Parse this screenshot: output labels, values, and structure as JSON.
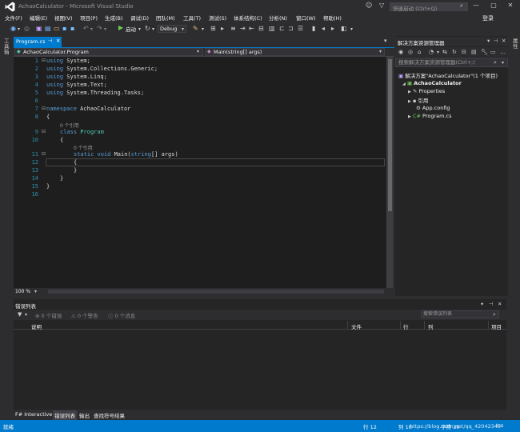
{
  "window": {
    "title": "AchaoCalculator - Microsoft Visual Studio",
    "quick_launch_placeholder": "快速启动 (Ctrl+Q)",
    "controls": [
      "—",
      "▢",
      "✕"
    ]
  },
  "menu": [
    "文件(F)",
    "编辑(E)",
    "视图(V)",
    "项目(P)",
    "生成(B)",
    "调试(D)",
    "团队(M)",
    "工具(T)",
    "测试(S)",
    "体系结构(C)",
    "分析(N)",
    "窗口(W)",
    "帮助(H)"
  ],
  "login_label": "登录",
  "toolbar": {
    "start_label": "启动",
    "config_value": "Debug"
  },
  "left_strip": {
    "toolbox_label": "工具箱"
  },
  "editor": {
    "tab_label": "Program.cs",
    "nav_left": "AchaoCalculator.Program",
    "nav_right": "Main(string[] args)",
    "zoom": "100 %",
    "ref_count_label": "0 个引用",
    "lines": [
      {
        "n": "1",
        "kw": "using",
        "rest": " System;"
      },
      {
        "n": "2",
        "kw": "using",
        "rest": " System.Collections.Generic;"
      },
      {
        "n": "3",
        "kw": "using",
        "rest": " System.Linq;"
      },
      {
        "n": "4",
        "kw": "using",
        "rest": " System.Text;"
      },
      {
        "n": "5",
        "kw": "using",
        "rest": " System.Threading.Tasks;"
      },
      {
        "n": "6"
      },
      {
        "n": "7",
        "kw": "namespace",
        "rest": " AchaoCalculator"
      },
      {
        "n": "8",
        "rest": "{"
      },
      {
        "n": "9",
        "kw": "class",
        "type": "Program"
      },
      {
        "n": "10",
        "rest": "{"
      },
      {
        "n": "11",
        "kw": "static void",
        "rest": " Main(",
        "kw2": "string",
        "rest2": "[] args)"
      },
      {
        "n": "12",
        "rest": "{"
      },
      {
        "n": "13",
        "rest": "}"
      },
      {
        "n": "14",
        "rest": "}"
      },
      {
        "n": "15",
        "rest": "}"
      },
      {
        "n": "16"
      }
    ]
  },
  "solution_explorer": {
    "title": "解决方案资源管理器",
    "search_placeholder": "搜索解决方案资源管理器(Ctrl+;)",
    "items": [
      {
        "label": "解决方案\"AchaoCalculator\"(1 个项目)"
      },
      {
        "label": "AchaoCalculator"
      },
      {
        "label": "Properties"
      },
      {
        "label": "引用"
      },
      {
        "label": "App.config"
      },
      {
        "label": "Program.cs"
      }
    ]
  },
  "right_strip": {
    "properties_label": "属性"
  },
  "error_list": {
    "title": "错误列表",
    "errors_label": "0 个错误",
    "warnings_label": "0 个警告",
    "messages_label": "0 个消息",
    "search_placeholder": "搜索错误列表",
    "columns": [
      "说明",
      "文件",
      "行",
      "列",
      "项目"
    ]
  },
  "bottom_tabs": [
    "F# Interactive",
    "错误列表",
    "输出",
    "查找符号结果"
  ],
  "status": {
    "left": "就绪",
    "line": "行 12",
    "col": "列 10",
    "char": "字符 10",
    "mode": "Ins",
    "watermark": "https://blog.csdn.net/qq_42042345"
  },
  "colors": {
    "accent": "#007acc",
    "keyword": "#569cd6",
    "type": "#4ec9b0",
    "line_number": "#2b91af"
  }
}
